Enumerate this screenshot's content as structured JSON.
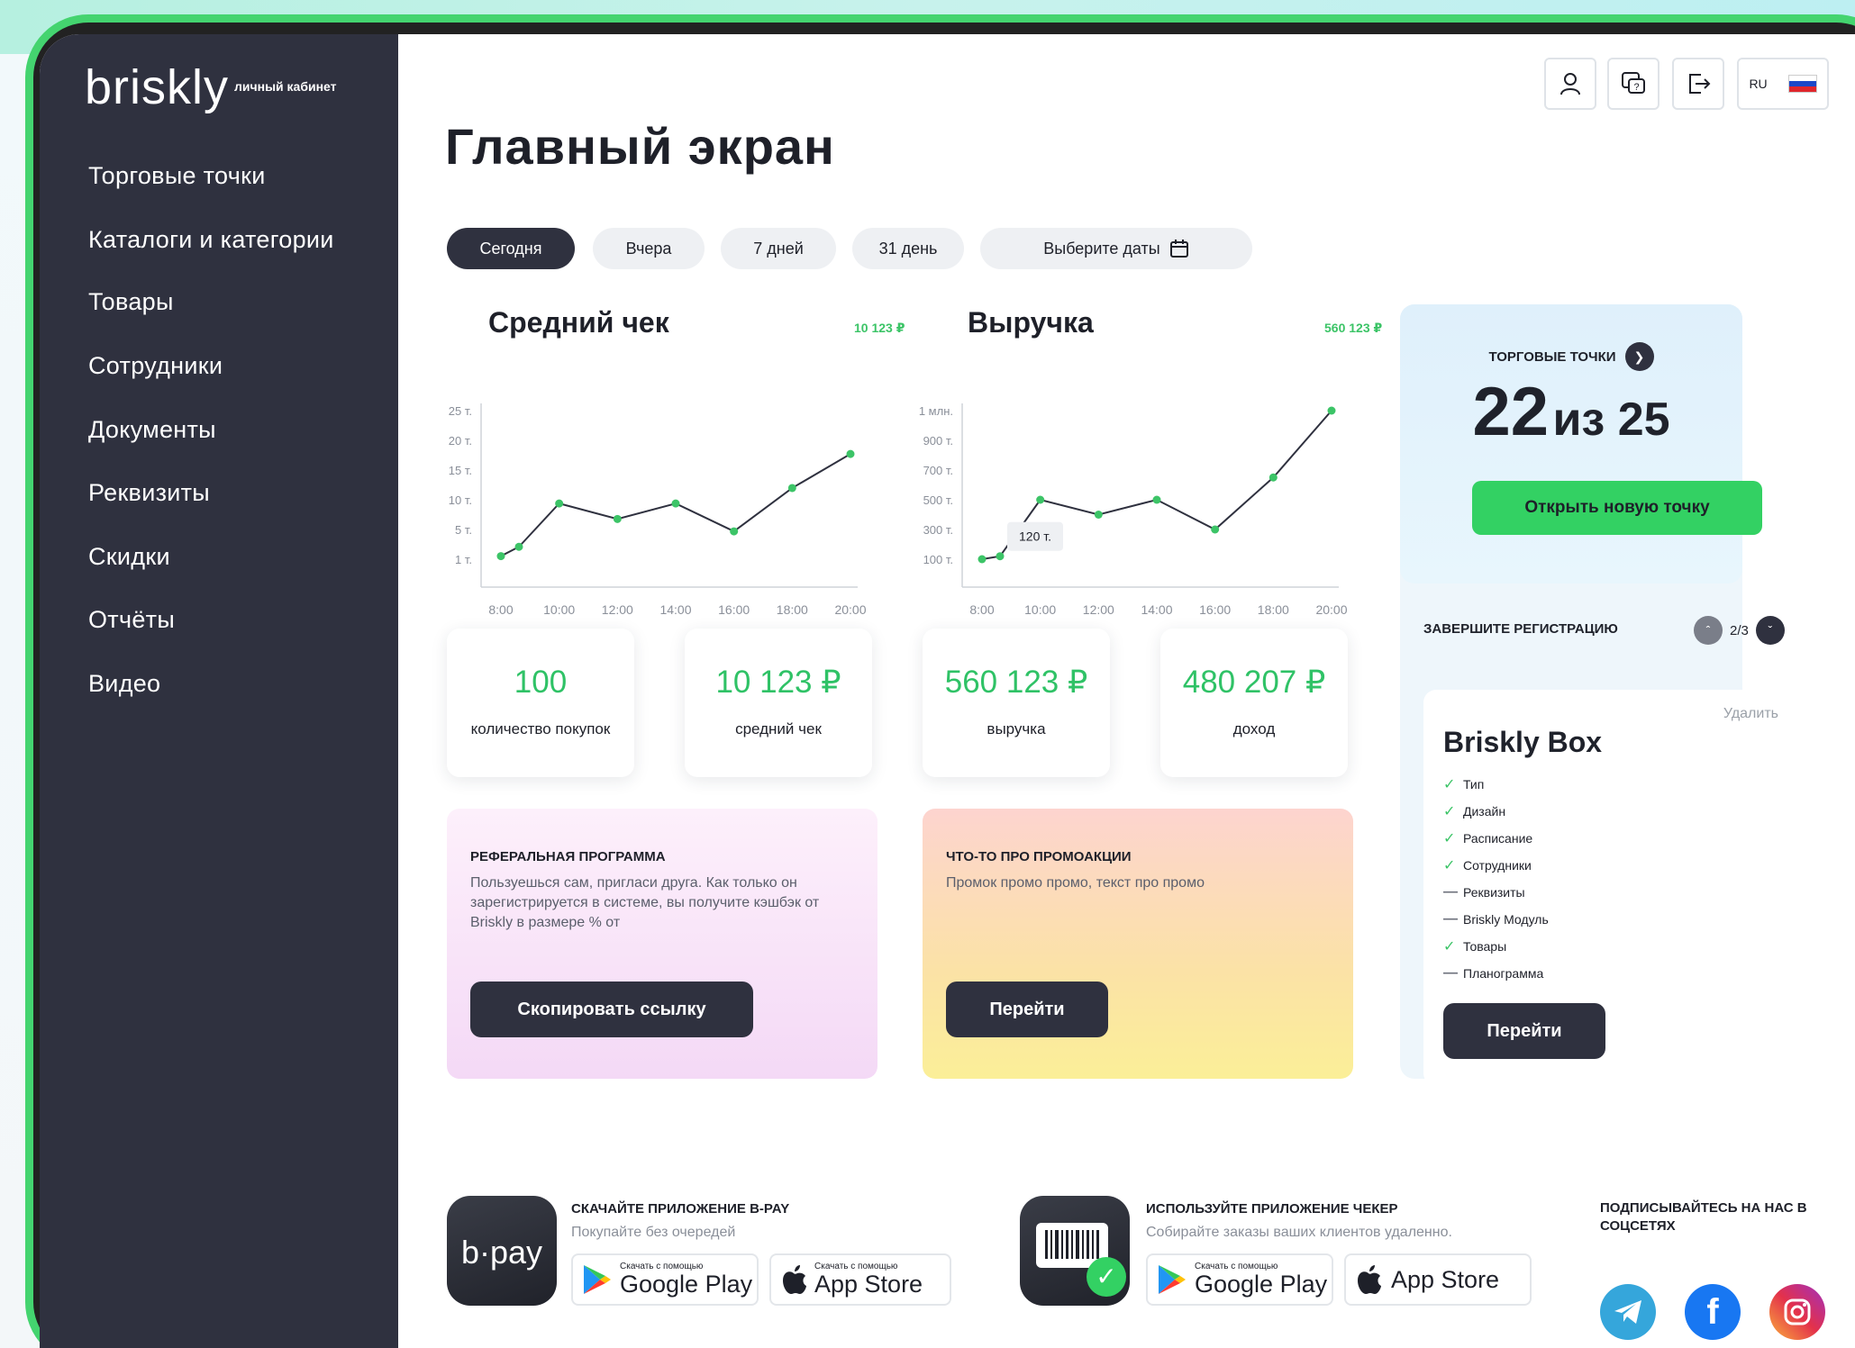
{
  "sidebar": {
    "logo": "briskly",
    "logo_sub": "личный кабинет",
    "items": [
      "Торговые точки",
      "Каталоги и категории",
      "Товары",
      "Сотрудники",
      "Документы",
      "Реквизиты",
      "Скидки",
      "Отчёты",
      "Видео"
    ]
  },
  "header": {
    "title": "Главный экран",
    "lang": "RU"
  },
  "filters": {
    "periods": [
      "Сегодня",
      "Вчера",
      "7 дней",
      "31 день"
    ],
    "active": "Сегодня",
    "date_picker": "Выберите даты"
  },
  "charts": {
    "avg_check": {
      "title": "Средний чек",
      "total": "10 123 ₽"
    },
    "revenue": {
      "title": "Выручка",
      "total": "560 123 ₽",
      "tooltip": "120 т."
    }
  },
  "chart_data": [
    {
      "type": "line",
      "title": "Средний чек",
      "x": [
        "8:00",
        "10:00",
        "12:00",
        "14:00",
        "16:00",
        "18:00",
        "20:00"
      ],
      "y_ticks": [
        "25 т.",
        "20 т.",
        "15 т.",
        "10 т.",
        "5 т.",
        "1 т."
      ],
      "series": [
        {
          "values": [
            1.5,
            3,
            10,
            7.5,
            10,
            5.5,
            12.5,
            18
          ]
        }
      ],
      "x_points": [
        "8:00",
        "8:30",
        "10:00",
        "12:00",
        "14:00",
        "16:00",
        "18:00",
        "20:00"
      ],
      "ylim": [
        0,
        25
      ]
    },
    {
      "type": "line",
      "title": "Выручка",
      "x": [
        "8:00",
        "10:00",
        "12:00",
        "14:00",
        "16:00",
        "18:00",
        "20:00"
      ],
      "y_ticks": [
        "1 млн.",
        "900 т.",
        "700 т.",
        "500 т.",
        "300 т.",
        "100 т."
      ],
      "series": [
        {
          "values": [
            100,
            120,
            500,
            400,
            500,
            300,
            650,
            1000
          ]
        }
      ],
      "x_points": [
        "8:00",
        "8:30",
        "10:00",
        "12:00",
        "14:00",
        "16:00",
        "18:00",
        "20:00"
      ]
    }
  ],
  "stats": [
    {
      "value": "100",
      "label": "количество покупок"
    },
    {
      "value": "10 123 ₽",
      "label": "средний чек"
    },
    {
      "value": "560 123 ₽",
      "label": "выручка"
    },
    {
      "value": "480 207 ₽",
      "label": "доход"
    }
  ],
  "referral": {
    "title": "РЕФЕРАЛЬНАЯ ПРОГРАММА",
    "text": "Пользуешься сам, пригласи друга. Как только он зарегистрируется в системе, вы получите кэшбэк от Briskly в размере % от",
    "button": "Скопировать ссылку"
  },
  "promo": {
    "title": "ЧТО-ТО ПРО ПРОМОАКЦИИ",
    "text": "Промок промо промо, текст про промо",
    "button": "Перейти"
  },
  "points": {
    "label": "ТОРГОВЫЕ ТОЧКИ",
    "count": "22",
    "of": "из 25",
    "button": "Открыть новую точку"
  },
  "registration": {
    "title": "ЗАВЕРШИТЕ РЕГИСТРАЦИЮ",
    "pager": "2/3",
    "card_title": "Briskly Box",
    "delete": "Удалить",
    "steps": [
      {
        "label": "Тип",
        "done": true
      },
      {
        "label": "Дизайн",
        "done": true
      },
      {
        "label": "Расписание",
        "done": true
      },
      {
        "label": "Сотрудники",
        "done": true
      },
      {
        "label": "Реквизиты",
        "done": false
      },
      {
        "label": "Briskly Модуль",
        "done": false
      },
      {
        "label": "Товары",
        "done": true
      },
      {
        "label": "Планограмма",
        "done": false
      }
    ],
    "button": "Перейти"
  },
  "footer": {
    "bpay": {
      "icon_text": "b·pay",
      "title": "СКАЧАЙТЕ ПРИЛОЖЕНИЕ B-PAY",
      "desc": "Покупайте без очередей"
    },
    "checker": {
      "title": "ИСПОЛЬЗУЙТЕ ПРИЛОЖЕНИЕ ЧЕКЕР",
      "desc": "Собирайте заказы ваших клиентов удаленно."
    },
    "store_small": "Скачать с помощью",
    "google_play": "Google Play",
    "app_store": "App Store",
    "social_title": "ПОДПИСЫВАЙТЕСЬ НА НАС В СОЦСЕТЯХ"
  }
}
